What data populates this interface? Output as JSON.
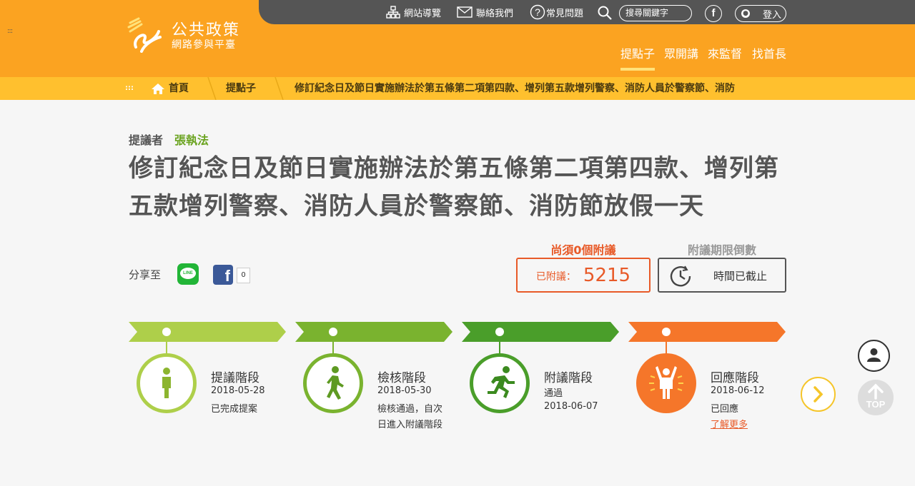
{
  "header": {
    "site_title": "公共政策",
    "site_subtitle": "網路參與平臺",
    "topbar": {
      "sitemap": "網站導覽",
      "contact": "聯絡我們",
      "faq": "常見問題",
      "search_placeholder": "搜尋關鍵字",
      "facebook": "f",
      "login": "登入"
    },
    "nav": [
      "提點子",
      "眾開講",
      "來監督",
      "找首長"
    ]
  },
  "breadcrumb": {
    "home": "首頁",
    "section": "提點子",
    "current": "修訂紀念日及節日實施辦法於第五條第二項第四款、增列第五款增列警察、消防人員於警察節、消防"
  },
  "proposal": {
    "proposer_label": "提議者",
    "proposer_name": "張執法",
    "title": "修訂紀念日及節日實施辦法於第五條第二項第四款、增列第五款增列警察、消防人員於警察節、消防節放假一天",
    "share_label": "分享至",
    "line_label": "LINE",
    "fb_count": "0",
    "need_label": "尚須0個附議",
    "seconded_label": "已附議：",
    "seconded_count": "5215",
    "deadline_label": "附議期限倒數",
    "deadline_status": "時間已截止"
  },
  "timeline": {
    "stages": [
      {
        "title": "提議階段",
        "lines": [
          "2018-05-28",
          "已完成提案"
        ],
        "color": "#aecf4a",
        "icon": "standing-person-icon"
      },
      {
        "title": "檢核階段",
        "lines": [
          "2018-05-30",
          "檢核通過，自次",
          "日進入附議階段"
        ],
        "color": "#7ab32f",
        "icon": "walking-person-icon"
      },
      {
        "title": "附議階段",
        "lines": [
          "通過",
          "2018-06-07"
        ],
        "color": "#4a9e2a",
        "icon": "running-person-icon"
      },
      {
        "title": "回應階段",
        "lines": [
          "2018-06-12",
          "已回應"
        ],
        "link": "了解更多",
        "color": "#f5762a",
        "icon": "cheering-person-icon"
      }
    ]
  },
  "floating": {
    "top_label": "TOP"
  },
  "colors": {
    "header": "#fba321",
    "breadcrumb": "#ffc02e",
    "accent_red": "#e85a28",
    "green": "#6aa31f"
  }
}
